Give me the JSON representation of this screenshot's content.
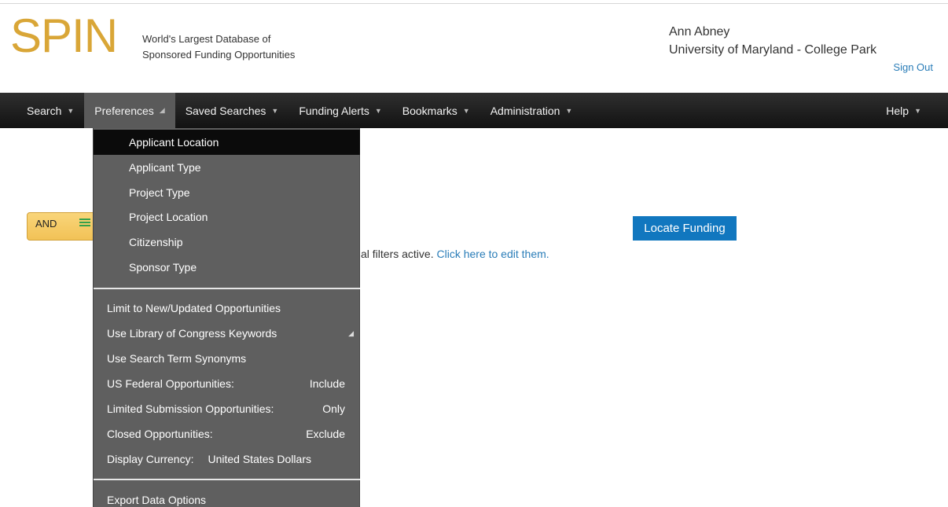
{
  "header": {
    "logo": "SPIN",
    "tagline_line1": "World's Largest Database of",
    "tagline_line2": "Sponsored Funding Opportunities",
    "user_name": "Ann Abney",
    "institution": "University of Maryland - College Park",
    "sign_out": "Sign Out"
  },
  "nav": {
    "search": "Search",
    "preferences": "Preferences",
    "saved_searches": "Saved Searches",
    "funding_alerts": "Funding Alerts",
    "bookmarks": "Bookmarks",
    "administration": "Administration",
    "help": "Help"
  },
  "main": {
    "and_label": "AND",
    "filters_text": "al filters active. ",
    "filters_link": "Click here to edit them.",
    "locate_button": "Locate Funding"
  },
  "dropdown": {
    "group1": [
      "Applicant Location",
      "Applicant Type",
      "Project Type",
      "Project Location",
      "Citizenship",
      "Sponsor Type"
    ],
    "limit_new": "Limit to New/Updated Opportunities",
    "loc_keywords": "Use Library of Congress Keywords",
    "synonyms": "Use Search Term Synonyms",
    "federal_label": "US Federal Opportunities:",
    "federal_value": "Include",
    "limited_label": "Limited Submission Opportunities:",
    "limited_value": "Only",
    "closed_label": "Closed Opportunities:",
    "closed_value": "Exclude",
    "currency_label": "Display Currency:",
    "currency_value": "United States Dollars",
    "export": "Export Data Options"
  }
}
